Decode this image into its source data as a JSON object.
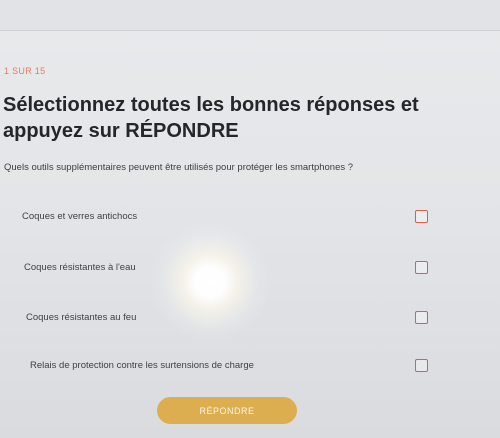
{
  "quiz": {
    "progress": "1 SUR 15",
    "title": "Sélectionnez toutes les bonnes réponses et appuyez sur RÉPONDRE",
    "question": "Quels outils supplémentaires peuvent être utilisés pour protéger les smartphones ?",
    "options": [
      {
        "label": "Coques et verres antichocs",
        "checked": false
      },
      {
        "label": "Coques résistantes à l'eau",
        "checked": false
      },
      {
        "label": "Coques résistantes au feu",
        "checked": false
      },
      {
        "label": "Relais de protection contre les surtensions de charge",
        "checked": false
      }
    ],
    "submit_label": "RÉPONDRE"
  },
  "colors": {
    "accent": "#d9604a",
    "button": "#dcae4f",
    "text": "#24262b",
    "background": "#e5e7ea"
  },
  "icons": {
    "checkbox": "checkbox-empty-icon"
  }
}
